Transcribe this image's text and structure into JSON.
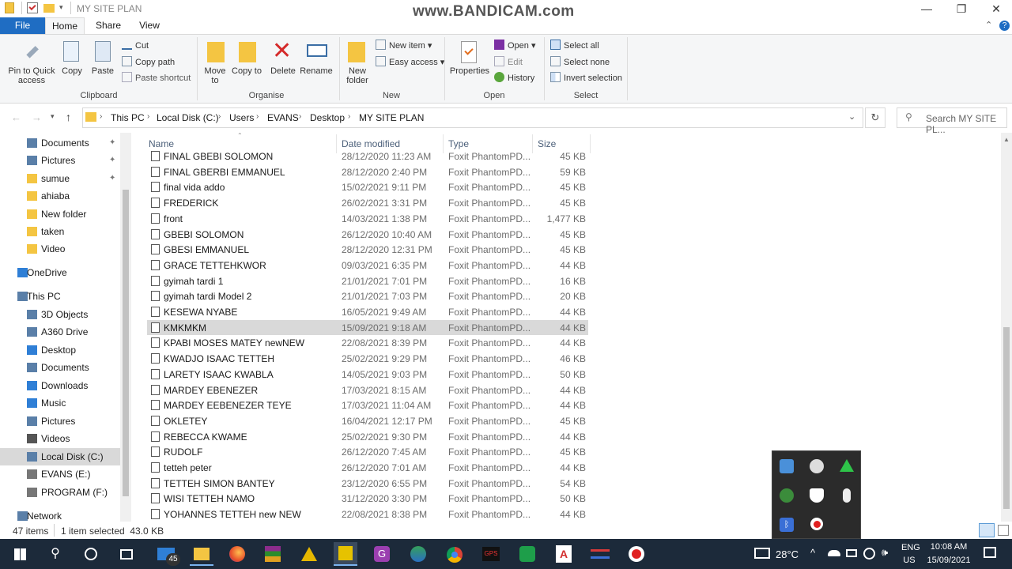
{
  "window": {
    "title": "MY SITE PLAN",
    "watermark": "www.BANDICAM.com",
    "minimize": "—",
    "maximize": "❐",
    "close": "✕"
  },
  "ribbon": {
    "tabs": [
      "File",
      "Home",
      "Share",
      "View"
    ],
    "clipboard": {
      "pin": "Pin to Quick access",
      "copy": "Copy",
      "paste": "Paste",
      "cut": "Cut",
      "copy_path": "Copy path",
      "paste_shortcut": "Paste shortcut",
      "label": "Clipboard"
    },
    "organise": {
      "move_to": "Move to",
      "copy_to": "Copy to",
      "delete": "Delete",
      "rename": "Rename",
      "label": "Organise"
    },
    "new": {
      "new_folder": "New folder",
      "new_item": "New item",
      "easy_access": "Easy access",
      "label": "New"
    },
    "open": {
      "properties": "Properties",
      "open": "Open",
      "edit": "Edit",
      "history": "History",
      "label": "Open"
    },
    "select": {
      "select_all": "Select all",
      "select_none": "Select none",
      "invert": "Invert selection",
      "label": "Select"
    }
  },
  "address": {
    "crumbs": [
      "This PC",
      "Local Disk (C:)",
      "Users",
      "EVANS",
      "Desktop",
      "MY SITE PLAN"
    ],
    "search_placeholder": "Search MY SITE PL..."
  },
  "nav": [
    {
      "label": "Documents",
      "pinned": true
    },
    {
      "label": "Pictures",
      "pinned": true
    },
    {
      "label": "sumue",
      "pinned": true
    },
    {
      "label": "ahiaba",
      "pinned": false
    },
    {
      "label": "New folder",
      "pinned": false
    },
    {
      "label": "taken",
      "pinned": false
    },
    {
      "label": "Video",
      "pinned": false
    },
    {
      "label": "OneDrive",
      "pinned": false
    },
    {
      "label": "This PC",
      "pinned": false
    },
    {
      "label": "3D Objects",
      "pinned": false
    },
    {
      "label": "A360 Drive",
      "pinned": false
    },
    {
      "label": "Desktop",
      "pinned": false
    },
    {
      "label": "Documents",
      "pinned": false
    },
    {
      "label": "Downloads",
      "pinned": false
    },
    {
      "label": "Music",
      "pinned": false
    },
    {
      "label": "Pictures",
      "pinned": false
    },
    {
      "label": "Videos",
      "pinned": false
    },
    {
      "label": "Local Disk (C:)",
      "pinned": false
    },
    {
      "label": "EVANS (E:)",
      "pinned": false
    },
    {
      "label": "PROGRAM  (F:)",
      "pinned": false
    },
    {
      "label": "Network",
      "pinned": false
    }
  ],
  "columns": {
    "name": "Name",
    "date": "Date modified",
    "type": "Type",
    "size": "Size"
  },
  "files": [
    {
      "name": "FINAL GBEBI SOLOMON",
      "date": "28/12/2020 11:23 AM",
      "type": "Foxit PhantomPD...",
      "size": "45 KB"
    },
    {
      "name": "FINAL GBERBI EMMANUEL",
      "date": "28/12/2020 2:40 PM",
      "type": "Foxit PhantomPD...",
      "size": "59 KB"
    },
    {
      "name": "final vida addo",
      "date": "15/02/2021 9:11 PM",
      "type": "Foxit PhantomPD...",
      "size": "45 KB"
    },
    {
      "name": "FREDERICK",
      "date": "26/02/2021 3:31 PM",
      "type": "Foxit PhantomPD...",
      "size": "45 KB"
    },
    {
      "name": "front",
      "date": "14/03/2021 1:38 PM",
      "type": "Foxit PhantomPD...",
      "size": "1,477 KB"
    },
    {
      "name": "GBEBI SOLOMON",
      "date": "26/12/2020 10:40 AM",
      "type": "Foxit PhantomPD...",
      "size": "45 KB"
    },
    {
      "name": "GBESI EMMANUEL",
      "date": "28/12/2020 12:31 PM",
      "type": "Foxit PhantomPD...",
      "size": "45 KB"
    },
    {
      "name": "GRACE TETTEHKWOR",
      "date": "09/03/2021 6:35 PM",
      "type": "Foxit PhantomPD...",
      "size": "44 KB"
    },
    {
      "name": "gyimah tardi 1",
      "date": "21/01/2021 7:01 PM",
      "type": "Foxit PhantomPD...",
      "size": "16 KB"
    },
    {
      "name": "gyimah tardi Model 2",
      "date": "21/01/2021 7:03 PM",
      "type": "Foxit PhantomPD...",
      "size": "20 KB"
    },
    {
      "name": "KESEWA NYABE",
      "date": "16/05/2021 9:49 AM",
      "type": "Foxit PhantomPD...",
      "size": "44 KB"
    },
    {
      "name": "KMKMKM",
      "date": "15/09/2021 9:18 AM",
      "type": "Foxit PhantomPD...",
      "size": "44 KB",
      "selected": true
    },
    {
      "name": "KPABI MOSES MATEY newNEW",
      "date": "22/08/2021 8:39 PM",
      "type": "Foxit PhantomPD...",
      "size": "44 KB"
    },
    {
      "name": "KWADJO ISAAC TETTEH",
      "date": "25/02/2021 9:29 PM",
      "type": "Foxit PhantomPD...",
      "size": "46 KB"
    },
    {
      "name": "LARETY ISAAC KWABLA",
      "date": "14/05/2021 9:03 PM",
      "type": "Foxit PhantomPD...",
      "size": "50 KB"
    },
    {
      "name": "MARDEY EBENEZER",
      "date": "17/03/2021 8:15 AM",
      "type": "Foxit PhantomPD...",
      "size": "44 KB"
    },
    {
      "name": "MARDEY EEBENEZER TEYE",
      "date": "17/03/2021 11:04 AM",
      "type": "Foxit PhantomPD...",
      "size": "44 KB"
    },
    {
      "name": "OKLETEY",
      "date": "16/04/2021 12:17 PM",
      "type": "Foxit PhantomPD...",
      "size": "45 KB"
    },
    {
      "name": "REBECCA KWAME",
      "date": "25/02/2021 9:30 PM",
      "type": "Foxit PhantomPD...",
      "size": "44 KB"
    },
    {
      "name": "RUDOLF",
      "date": "26/12/2020 7:45 AM",
      "type": "Foxit PhantomPD...",
      "size": "45 KB"
    },
    {
      "name": "tetteh peter",
      "date": "26/12/2020 7:01 AM",
      "type": "Foxit PhantomPD...",
      "size": "44 KB"
    },
    {
      "name": "TETTEH SIMON BANTEY",
      "date": "23/12/2020 6:55 PM",
      "type": "Foxit PhantomPD...",
      "size": "54 KB"
    },
    {
      "name": "WISI TETTEH NAMO",
      "date": "31/12/2020 3:30 PM",
      "type": "Foxit PhantomPD...",
      "size": "50 KB"
    },
    {
      "name": "YOHANNES TETTEH new NEW",
      "date": "22/08/2021 8:38 PM",
      "type": "Foxit PhantomPD...",
      "size": "44 KB"
    }
  ],
  "status": {
    "count": "47 items",
    "selection": "1 item selected  43.0 KB"
  },
  "taskbar": {
    "mail_badge": "45",
    "temperature": "28°C",
    "lang1": "ENG",
    "lang2": "US",
    "time": "10:08 AM",
    "date": "15/09/2021"
  },
  "colors": {
    "accent": "#1f6dc3",
    "taskbar": "#1c2a3a",
    "selected_row": "#d9d9d9"
  }
}
